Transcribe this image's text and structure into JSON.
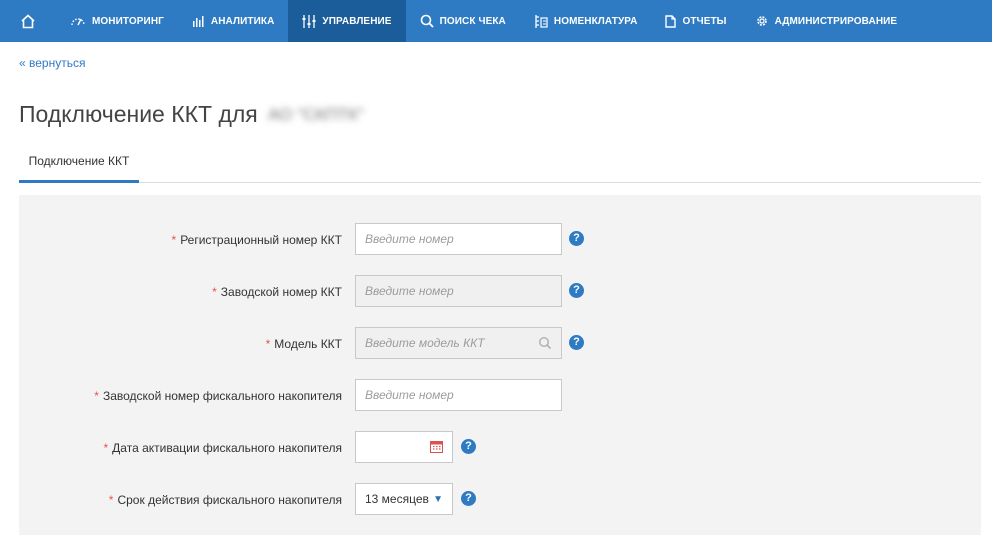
{
  "nav": {
    "items": [
      {
        "label": "Мониторинг",
        "icon": "gauge-icon"
      },
      {
        "label": "Аналитика",
        "icon": "bar-chart-icon"
      },
      {
        "label": "Управление",
        "icon": "sliders-icon",
        "active": true
      },
      {
        "label": "Поиск чека",
        "icon": "search-icon"
      },
      {
        "label": "Номенклатура",
        "icon": "catalog-icon"
      },
      {
        "label": "Отчеты",
        "icon": "document-icon"
      },
      {
        "label": "Администрирование",
        "icon": "gear-icon"
      }
    ]
  },
  "back_link": "« вернуться",
  "page": {
    "title": "Подключение ККТ для",
    "org_name_blurred": "АО \"СКПТК\""
  },
  "tabs": [
    {
      "label": "Подключение ККТ",
      "active": true
    }
  ],
  "form": {
    "fields": [
      {
        "label": "Регистрационный номер ККТ",
        "placeholder": "Введите номер",
        "required": true
      },
      {
        "label": "Заводской номер ККТ",
        "placeholder": "Введите номер",
        "required": true
      },
      {
        "label": "Модель ККТ",
        "placeholder": "Введите модель ККТ",
        "required": true
      },
      {
        "label": "Заводской номер фискального накопителя",
        "placeholder": "Введите номер",
        "required": true
      },
      {
        "label": "Дата активации фискального накопителя",
        "placeholder": "",
        "required": true
      },
      {
        "label": "Срок действия фискального накопителя",
        "value": "13 месяцев",
        "required": true
      }
    ]
  },
  "colors": {
    "nav_bg": "#2e7bc4",
    "nav_active": "#1b5c9a",
    "required_star": "#e2574c",
    "help_icon": "#2e7bc4"
  }
}
